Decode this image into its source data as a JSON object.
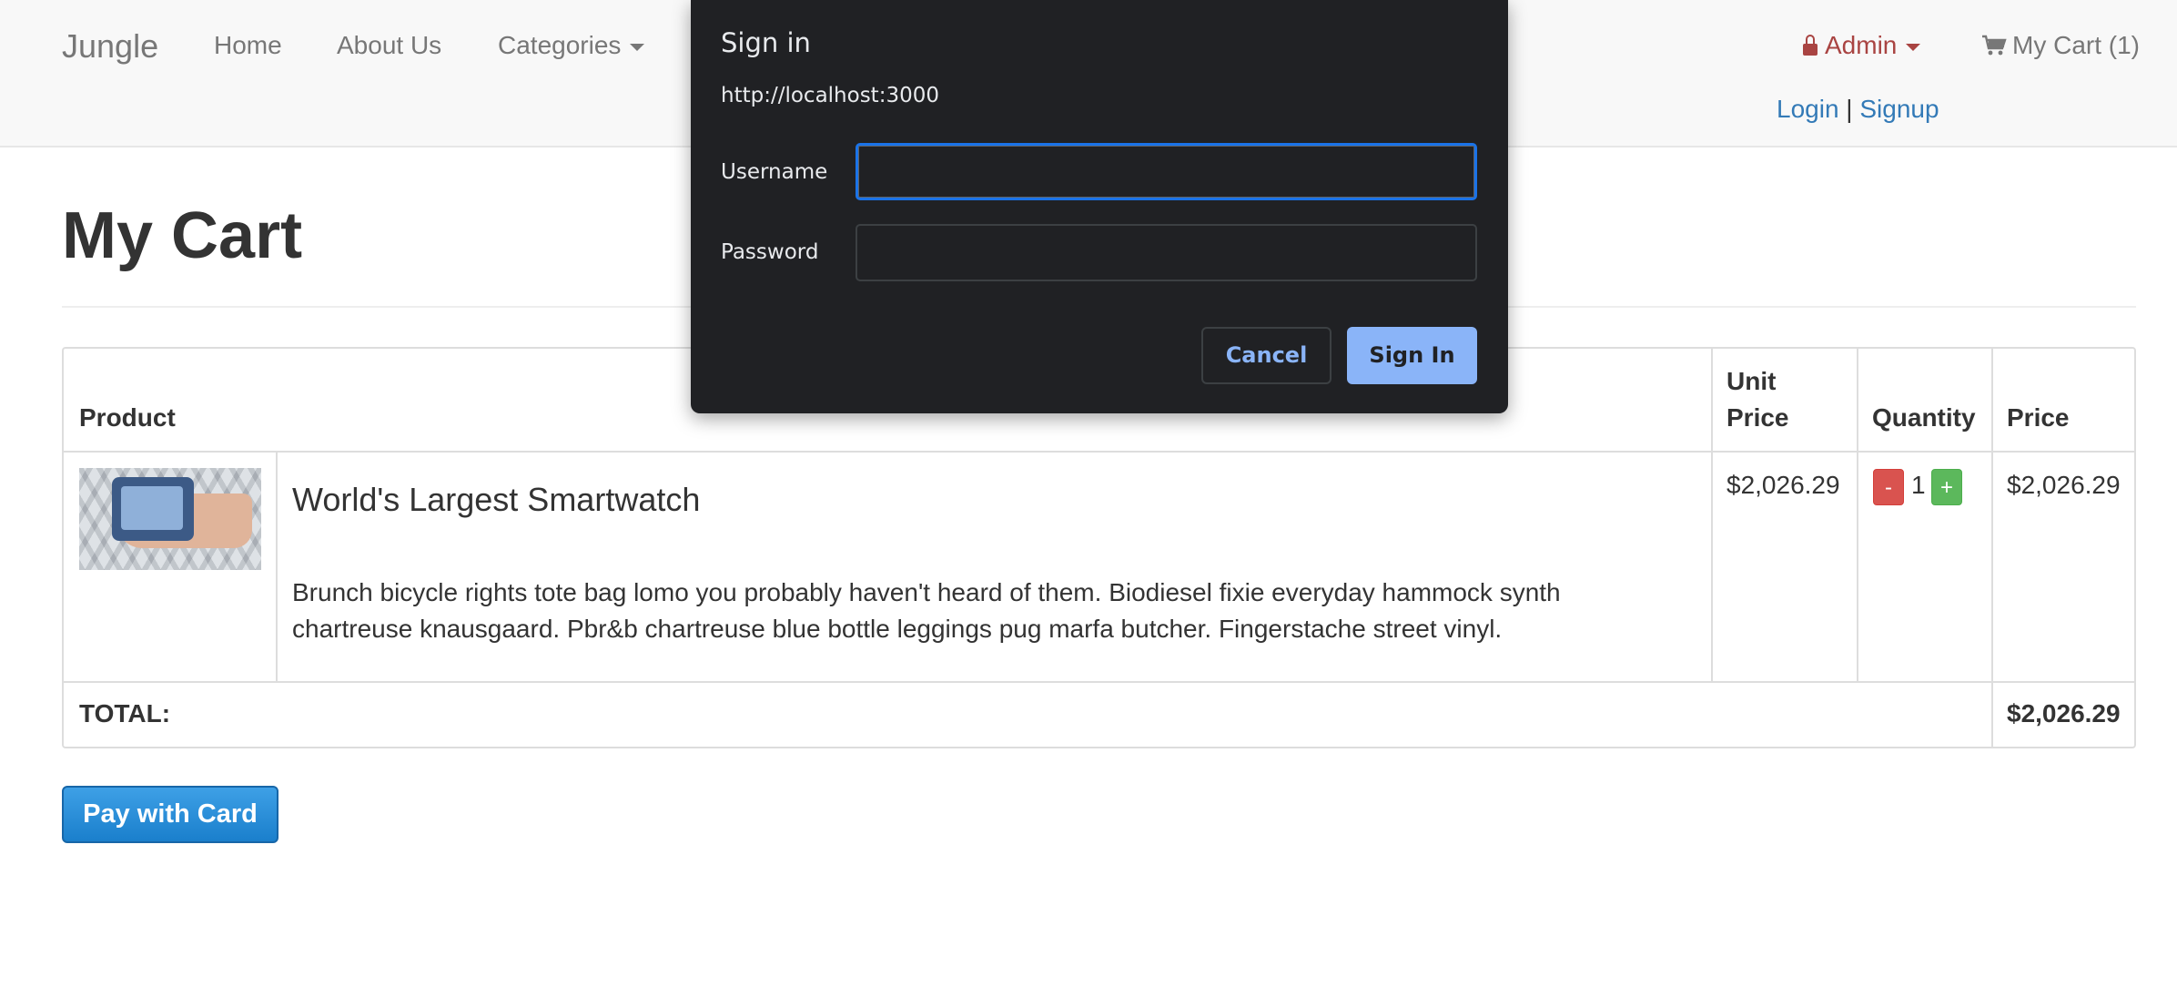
{
  "navbar": {
    "brand": "Jungle",
    "links": [
      "Home",
      "About Us",
      "Categories"
    ],
    "admin_label": "Admin",
    "cart_label": "My Cart (1)",
    "login": "Login",
    "separator": "|",
    "signup": "Signup"
  },
  "page": {
    "title": "My Cart"
  },
  "table": {
    "headers": {
      "product": "Product",
      "unit_price_line1": "Unit",
      "unit_price_line2": "Price",
      "quantity": "Quantity",
      "price": "Price"
    },
    "row": {
      "name": "World's Largest Smartwatch",
      "description": "Brunch bicycle rights tote bag lomo you probably haven't heard of them. Biodiesel fixie everyday hammock synth chartreuse knausgaard. Pbr&b chartreuse blue bottle leggings pug marfa butcher. Fingerstache street vinyl.",
      "unit_price": "$2,026.29",
      "quantity": "1",
      "minus": "-",
      "plus": "+",
      "price": "$2,026.29"
    },
    "total_label": "TOTAL:",
    "total_value": "$2,026.29"
  },
  "pay_button": "Pay with Card",
  "dialog": {
    "title": "Sign in",
    "origin": "http://localhost:3000",
    "username_label": "Username",
    "username_value": "",
    "password_label": "Password",
    "password_value": "",
    "cancel": "Cancel",
    "sign_in": "Sign In"
  },
  "colors": {
    "link": "#337ab7",
    "admin": "#a94442",
    "dialog_bg": "#202124",
    "dialog_primary": "#8ab4f8",
    "focus_ring": "#1a73e8",
    "danger": "#d9534f",
    "success": "#5cb85c"
  },
  "icons": [
    "lock-icon",
    "caret-down-icon",
    "shopping-cart-icon",
    "product-thumbnail"
  ]
}
